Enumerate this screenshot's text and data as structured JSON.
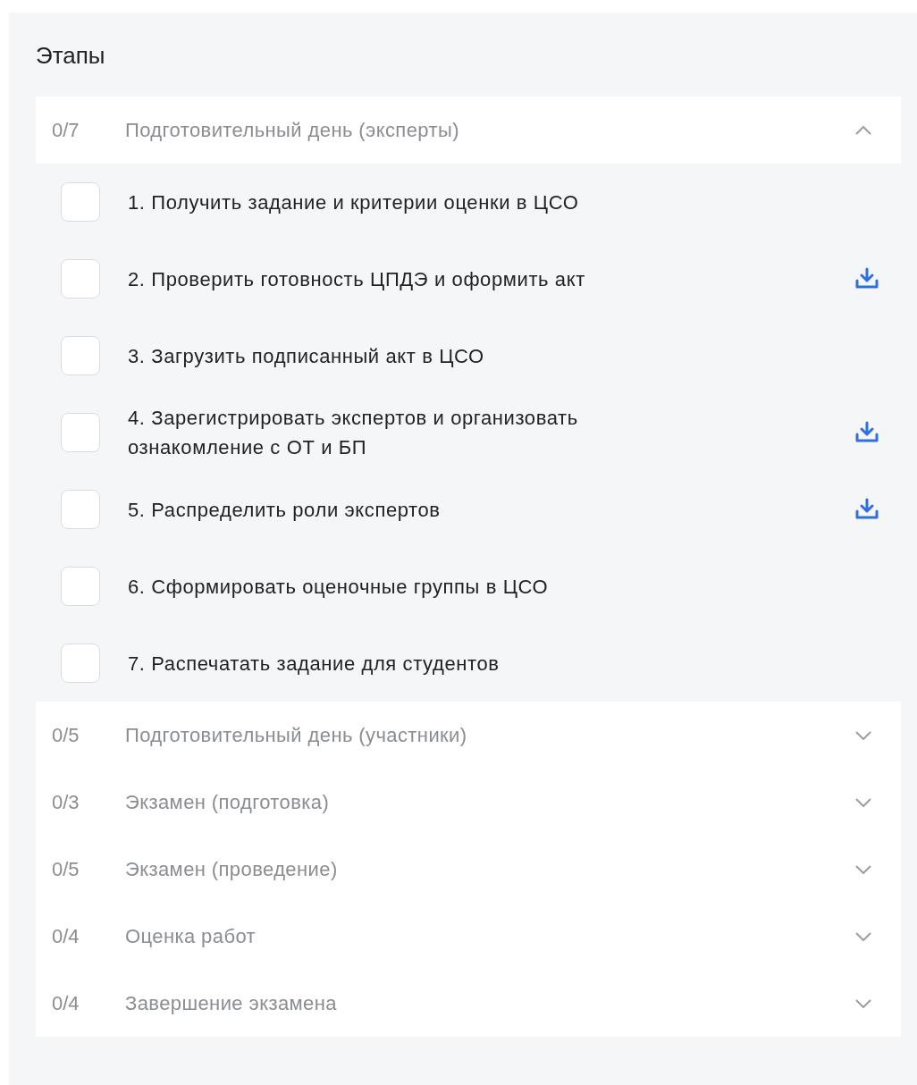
{
  "title": "Этапы",
  "stages": [
    {
      "count": "0/7",
      "title": "Подготовительный день (эксперты)",
      "expanded": true,
      "tasks": [
        {
          "label": "1. Получить задание и критерии оценки в ЦСО",
          "checked": false,
          "download": false
        },
        {
          "label": "2. Проверить готовность ЦПДЭ и оформить акт",
          "checked": false,
          "download": true
        },
        {
          "label": "3. Загрузить подписанный акт в ЦСО",
          "checked": false,
          "download": false
        },
        {
          "label": "4. Зарегистрировать экспертов и организовать ознакомление с ОТ и БП",
          "checked": false,
          "download": true
        },
        {
          "label": "5. Распределить роли экспертов",
          "checked": false,
          "download": true
        },
        {
          "label": "6. Сформировать оценочные группы в ЦСО",
          "checked": false,
          "download": false
        },
        {
          "label": "7. Распечатать задание для студентов",
          "checked": false,
          "download": false
        }
      ]
    },
    {
      "count": "0/5",
      "title": "Подготовительный день (участники)",
      "expanded": false
    },
    {
      "count": "0/3",
      "title": "Экзамен (подготовка)",
      "expanded": false
    },
    {
      "count": "0/5",
      "title": "Экзамен (проведение)",
      "expanded": false
    },
    {
      "count": "0/4",
      "title": "Оценка работ",
      "expanded": false
    },
    {
      "count": "0/4",
      "title": "Завершение экзамена",
      "expanded": false
    }
  ]
}
